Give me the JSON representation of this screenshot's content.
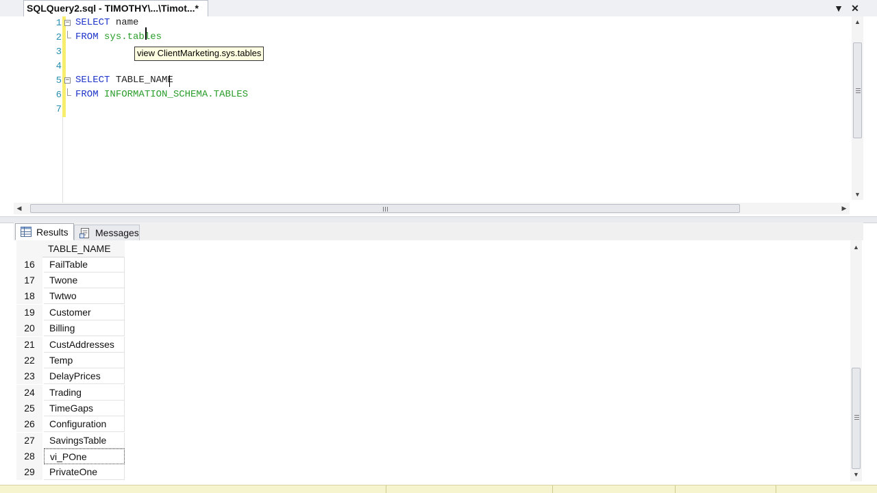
{
  "window": {
    "tab_title": "SQLQuery2.sql - TIMOTHY\\...\\Timot...*",
    "dropdown_glyph": "▼",
    "close_glyph": "✕"
  },
  "editor": {
    "lines": [
      {
        "num": "1",
        "keyword": "SELECT",
        "rest": " name",
        "rest_class": "tx"
      },
      {
        "num": "2",
        "keyword": "FROM",
        "rest": " sys.tables",
        "rest_class": "sys"
      },
      {
        "num": "3",
        "keyword": "",
        "rest": "",
        "rest_class": "tx"
      },
      {
        "num": "4",
        "keyword": "",
        "rest": "",
        "rest_class": "tx"
      },
      {
        "num": "5",
        "keyword": "SELECT",
        "rest": " TABLE_NAME",
        "rest_class": "tx"
      },
      {
        "num": "6",
        "keyword": "FROM",
        "rest": " INFORMATION_SCHEMA.TABLES",
        "rest_class": "sys"
      },
      {
        "num": "7",
        "keyword": "",
        "rest": "",
        "rest_class": "tx"
      }
    ],
    "tooltip": "view ClientMarketing.sys.tables",
    "colors": {
      "keyword": "#1f34c9",
      "system_object": "#2a9d2a",
      "line_number": "#2b91af",
      "change_marker": "#f7ee6e"
    }
  },
  "results": {
    "tabs": [
      {
        "label": "Results",
        "icon": "grid-icon"
      },
      {
        "label": "Messages",
        "icon": "messages-icon"
      }
    ],
    "column_header": "TABLE_NAME",
    "rows": [
      {
        "num": "16",
        "value": "FailTable"
      },
      {
        "num": "17",
        "value": "Twone"
      },
      {
        "num": "18",
        "value": "Twtwo"
      },
      {
        "num": "19",
        "value": "Customer"
      },
      {
        "num": "20",
        "value": "Billing"
      },
      {
        "num": "21",
        "value": "CustAddresses"
      },
      {
        "num": "22",
        "value": "Temp"
      },
      {
        "num": "23",
        "value": "DelayPrices"
      },
      {
        "num": "24",
        "value": "Trading"
      },
      {
        "num": "25",
        "value": "TimeGaps"
      },
      {
        "num": "26",
        "value": "Configuration"
      },
      {
        "num": "27",
        "value": "SavingsTable"
      },
      {
        "num": "28",
        "value": "vi_POne",
        "selected": true
      },
      {
        "num": "29",
        "value": "PrivateOne"
      }
    ]
  }
}
